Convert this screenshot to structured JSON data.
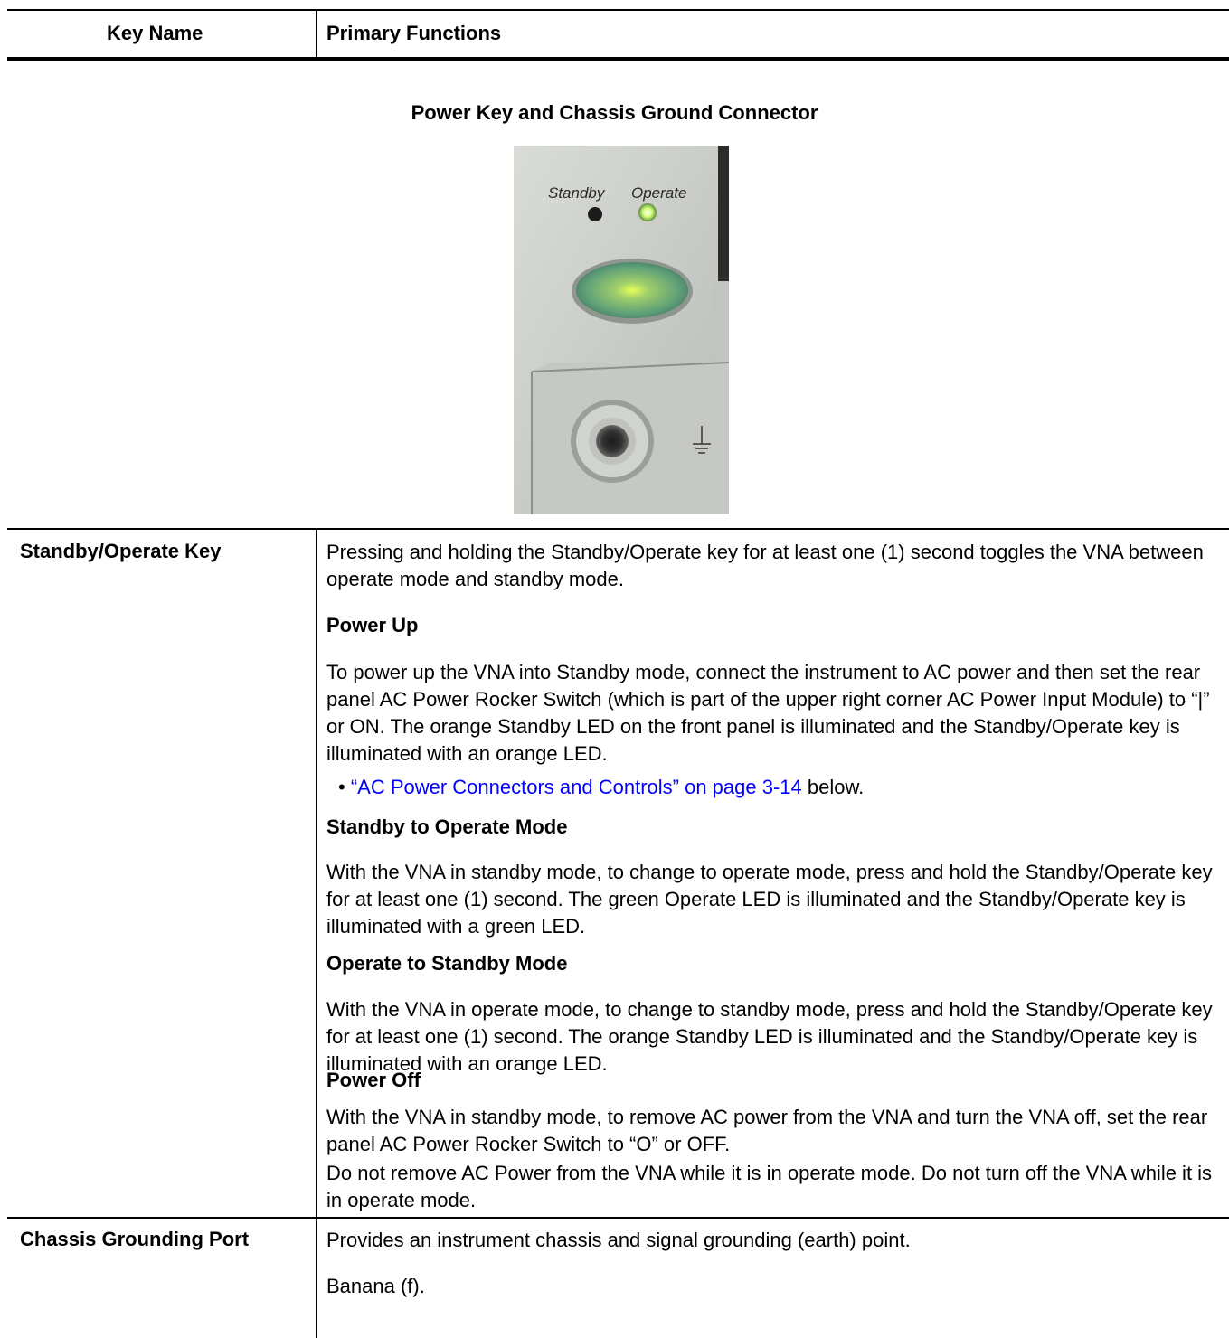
{
  "header": {
    "col1": "Key Name",
    "col2": "Primary Functions"
  },
  "figure": {
    "caption": "Power Key and Chassis Ground Connector",
    "standby_label": "Standby",
    "operate_label": "Operate"
  },
  "rows": {
    "standby_key": {
      "label": "Standby/Operate Key",
      "intro": "Pressing and holding the Standby/Operate key for at least one (1) second toggles the VNA between operate mode and standby mode.",
      "power_up": {
        "heading": "Power Up",
        "text": "To power up the VNA into Standby mode, connect the instrument to AC power and then set the rear panel AC Power Rocker Switch (which is part of the upper right corner AC Power Input Module) to “|” or ON. The orange Standby LED on the front panel is illuminated and the Standby/Operate key is illuminated with an orange LED.",
        "bullet_marker": "•",
        "bullet_link": "“AC Power Connectors and Controls” on page 3-14",
        "bullet_suffix": " below."
      },
      "standby_to_operate": {
        "heading": "Standby to Operate Mode",
        "text": "With the VNA in standby mode, to change to operate mode, press and hold the Standby/Operate key for at least one (1) second. The green Operate LED is illuminated and the Standby/Operate key is illuminated with a green LED."
      },
      "operate_to_standby": {
        "heading": "Operate to Standby Mode",
        "text": "With the VNA in operate mode, to change to standby mode, press and hold the Standby/Operate key for at least one (1) second. The orange Standby LED is illuminated and the Standby/Operate key is illuminated with an orange LED."
      },
      "power_off": {
        "heading": "Power Off",
        "text": "With the VNA in standby mode, to remove AC power from the VNA and turn the VNA off, set the rear panel AC Power Rocker Switch to “O” or OFF.",
        "note": "Do not remove AC Power from the VNA while it is in operate mode. Do not turn off the VNA while it is in operate mode."
      }
    },
    "ground": {
      "label": "Chassis Grounding Port",
      "text1": "Provides an instrument chassis and signal grounding (earth) point.",
      "text2": "Banana (f)."
    }
  },
  "colors": {
    "link": "#0000ff",
    "led_green": "#c8f08c",
    "button_green": "#5a9e6e"
  }
}
